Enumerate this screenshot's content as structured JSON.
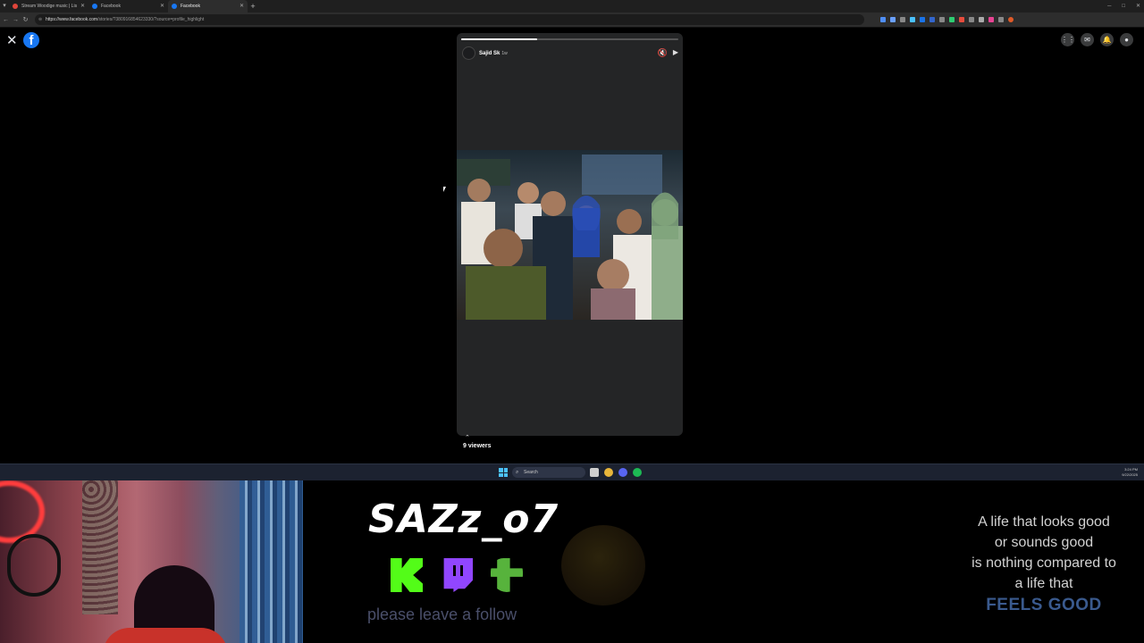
{
  "browser": {
    "tabs": [
      {
        "title": "Stream Woodige music | Lis",
        "color": "#e0453a",
        "active": false
      },
      {
        "title": "Facebook",
        "color": "#1877f2",
        "active": false
      },
      {
        "title": "Facebook",
        "color": "#1877f2",
        "active": true
      }
    ],
    "url_host": "https://www.facebook.com",
    "url_path": "/stories/?380916854623330/?source=profile_highlight"
  },
  "facebook": {
    "logo_letter": "f",
    "story": {
      "author": "Sajid Sk",
      "age": "1w",
      "progress": 0.35
    },
    "viewers_label": "9 viewers"
  },
  "taskbar": {
    "search_placeholder": "Search",
    "time": "3:24 PM",
    "date": "9/22/2025",
    "apps": [
      {
        "name": "file-explorer",
        "color": "#cfcfcf"
      },
      {
        "name": "chrome",
        "color": "#e8b63b"
      },
      {
        "name": "discord",
        "color": "#5865f2"
      },
      {
        "name": "spotify",
        "color": "#1db954"
      }
    ]
  },
  "overlay": {
    "brand": "SAZz_o7",
    "follow_text": "please leave a follow",
    "quote_lines": [
      "A life that looks good",
      "or sounds good",
      "is nothing compared to",
      "a life that"
    ],
    "quote_emphasis": "FEELS GOOD",
    "socials": [
      "kick",
      "twitch",
      "guilded"
    ]
  }
}
